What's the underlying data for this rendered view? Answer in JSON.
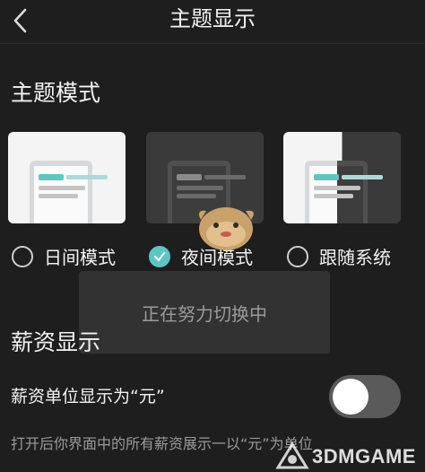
{
  "header": {
    "title": "主题显示",
    "back_icon": "chevron-left-icon"
  },
  "theme_section": {
    "title": "主题模式",
    "options": [
      {
        "label": "日间模式",
        "selected": false
      },
      {
        "label": "夜间模式",
        "selected": true
      },
      {
        "label": "跟随系统",
        "selected": false
      }
    ]
  },
  "toast": {
    "text": "正在努力切换中"
  },
  "salary_section": {
    "title": "薪资显示",
    "setting_label": "薪资单位显示为“元”",
    "toggle_on": false,
    "description": "打开后你界面中的所有薪资展示一以“元”为单位"
  },
  "watermark": {
    "text": "3DMGAME"
  },
  "colors": {
    "background": "#1e1e1e",
    "accent": "#5cc6c2",
    "toggle_off": "#5a5a5a",
    "secondary_text": "#9a9a9a"
  }
}
